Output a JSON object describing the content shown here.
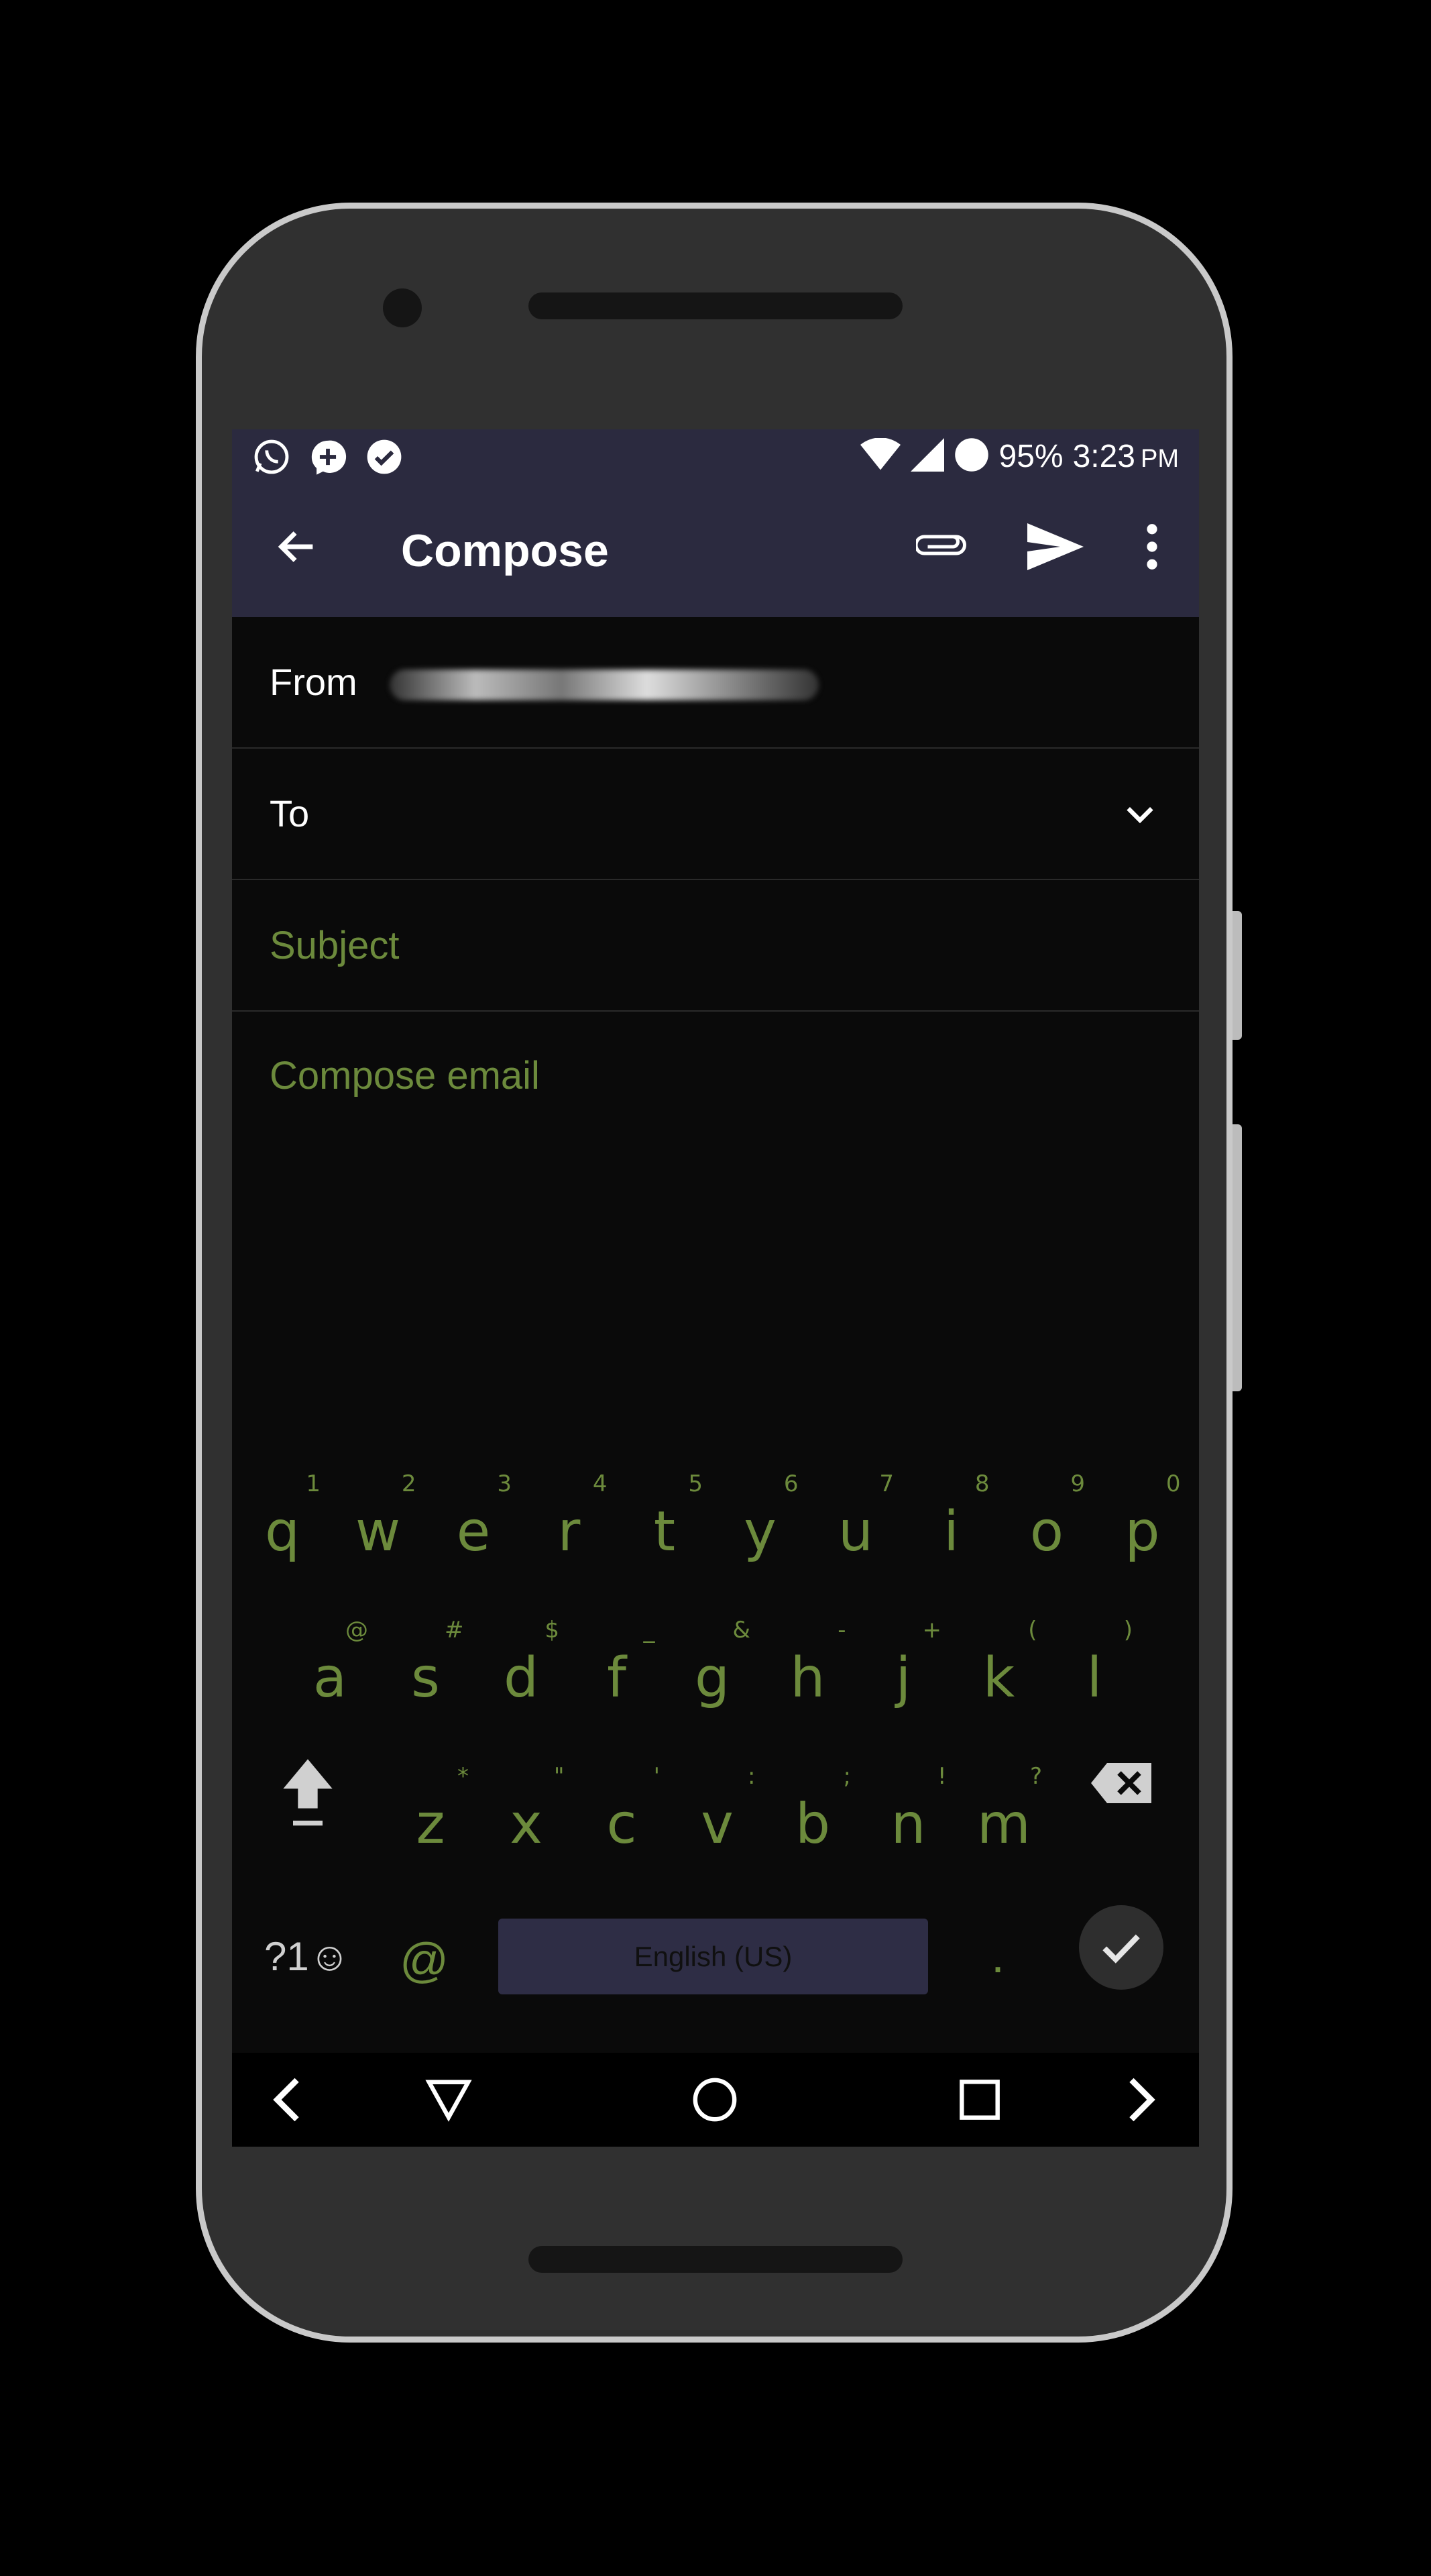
{
  "status_bar": {
    "notification_icons": [
      "whatsapp-icon",
      "chat-plus-icon",
      "check-circle-icon"
    ],
    "battery": "95%",
    "time": "3:23",
    "ampm": "PM"
  },
  "app_bar": {
    "title": "Compose",
    "actions": [
      "back-arrow-icon",
      "attach-icon",
      "send-icon",
      "more-vert-icon"
    ]
  },
  "form": {
    "from_label": "From",
    "to_label": "To",
    "subject_placeholder": "Subject",
    "body_placeholder": "Compose email"
  },
  "keyboard": {
    "row1": [
      {
        "key": "q",
        "hint": "1"
      },
      {
        "key": "w",
        "hint": "2"
      },
      {
        "key": "e",
        "hint": "3"
      },
      {
        "key": "r",
        "hint": "4"
      },
      {
        "key": "t",
        "hint": "5"
      },
      {
        "key": "y",
        "hint": "6"
      },
      {
        "key": "u",
        "hint": "7"
      },
      {
        "key": "i",
        "hint": "8"
      },
      {
        "key": "o",
        "hint": "9"
      },
      {
        "key": "p",
        "hint": "0"
      }
    ],
    "row2": [
      {
        "key": "a",
        "hint": "@"
      },
      {
        "key": "s",
        "hint": "#"
      },
      {
        "key": "d",
        "hint": "$"
      },
      {
        "key": "f",
        "hint": "_"
      },
      {
        "key": "g",
        "hint": "&"
      },
      {
        "key": "h",
        "hint": "-"
      },
      {
        "key": "j",
        "hint": "+"
      },
      {
        "key": "k",
        "hint": "("
      },
      {
        "key": "l",
        "hint": ")"
      }
    ],
    "row3": [
      {
        "key": "z",
        "hint": "*"
      },
      {
        "key": "x",
        "hint": "\""
      },
      {
        "key": "c",
        "hint": "'"
      },
      {
        "key": "v",
        "hint": ":"
      },
      {
        "key": "b",
        "hint": ";"
      },
      {
        "key": "n",
        "hint": "!"
      },
      {
        "key": "m",
        "hint": "?"
      }
    ],
    "symbols_label": "?1☺",
    "at_label": "@",
    "space_label": "English (US)",
    "period_label": "."
  },
  "nav_bar": [
    "chevron-left-icon",
    "back-triangle-icon",
    "home-circle-icon",
    "recents-square-icon",
    "chevron-right-icon"
  ],
  "colors": {
    "app_bar": "#2b2a3f",
    "accent_green": "#6c8a3c",
    "background": "#0a0a0a"
  }
}
